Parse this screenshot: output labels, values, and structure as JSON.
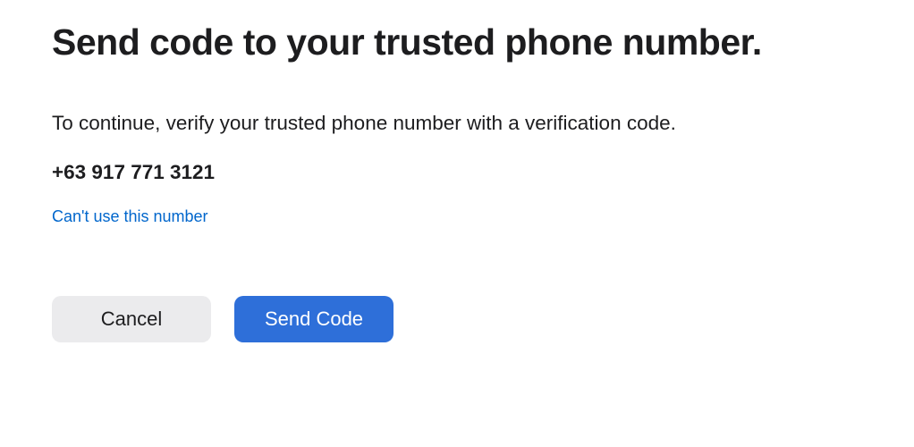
{
  "heading": "Send code to your trusted phone number.",
  "description": "To continue, verify your trusted phone number with a verification code.",
  "phone_number": "+63 917 771 3121",
  "link_text": "Can't use this number",
  "buttons": {
    "cancel": "Cancel",
    "send_code": "Send Code"
  }
}
